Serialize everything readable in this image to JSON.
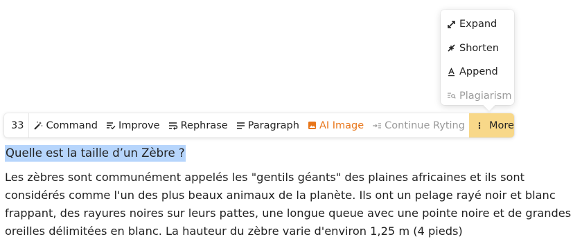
{
  "dropdown": {
    "items": [
      {
        "label": "Expand",
        "icon": "expand-icon",
        "disabled": false
      },
      {
        "label": "Shorten",
        "icon": "shorten-icon",
        "disabled": false
      },
      {
        "label": "Append",
        "icon": "append-icon",
        "disabled": false
      },
      {
        "label": "Plagiarism",
        "icon": "plagiarism-icon",
        "disabled": true
      }
    ]
  },
  "toolbar": {
    "count": "33",
    "command_label": "Command",
    "improve_label": "Improve",
    "rephrase_label": "Rephrase",
    "paragraph_label": "Paragraph",
    "ai_image_label": "AI Image",
    "continue_label": "Continue Ryting",
    "more_label": "More",
    "colors": {
      "accent_orange": "#e8761a",
      "more_bg": "#f8d889",
      "disabled": "#9a9a9a"
    }
  },
  "document": {
    "heading": "Quelle est la taille d’un Zèbre ?",
    "heading_highlight": "#b6d5fc",
    "paragraph": "Les zèbres sont communément appelés les \"gentils géants\" des plaines africaines et ils sont considérés comme l'un des plus beaux animaux de la planète. Ils ont un pelage rayé noir et blanc frappant, des rayures noires sur leurs pattes, une longue queue avec une pointe noire et de grandes oreilles délimitées en blanc. La hauteur du zèbre varie d'environ 1,25 m (4 pieds)"
  }
}
